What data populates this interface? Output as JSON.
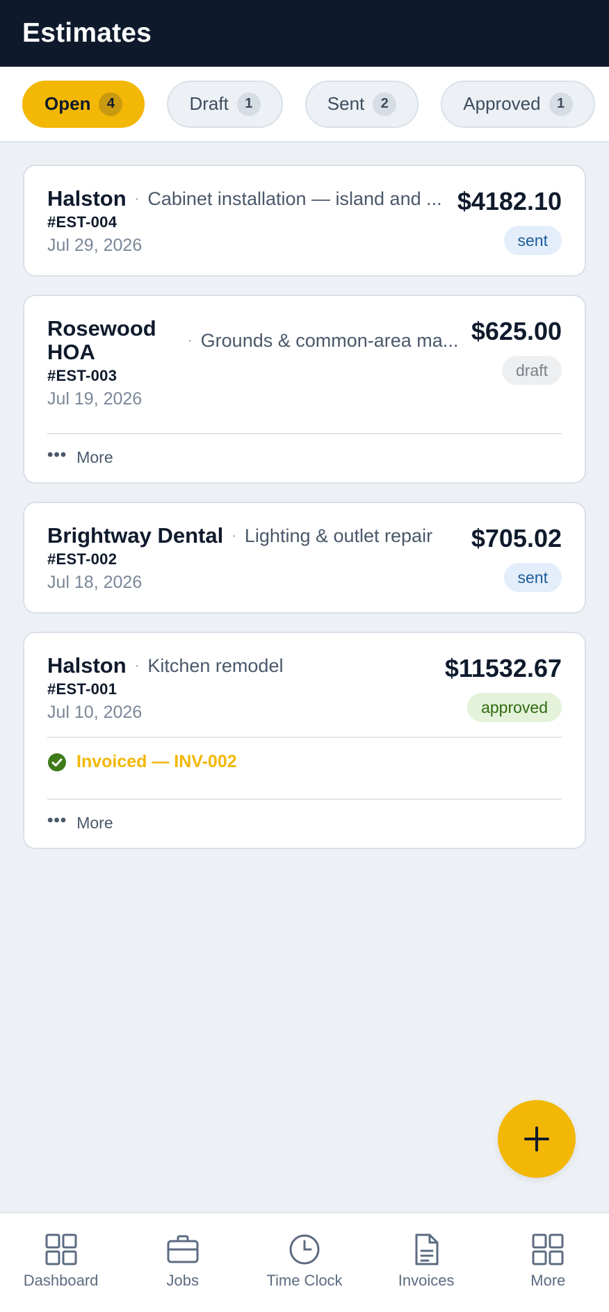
{
  "header": {
    "title": "Estimates"
  },
  "filters": [
    {
      "label": "Open",
      "count": "4",
      "active": true
    },
    {
      "label": "Draft",
      "count": "1"
    },
    {
      "label": "Sent",
      "count": "2"
    },
    {
      "label": "Approved",
      "count": "1"
    }
  ],
  "estimates": [
    {
      "client": "Halston",
      "description": "Cabinet installation — island and ...",
      "number": "#EST-004",
      "date": "Jul 29, 2026",
      "amount": "$4182.10",
      "status": "sent"
    },
    {
      "client": "Rosewood HOA",
      "description": "Grounds & common-area ma...",
      "number": "#EST-003",
      "date": "Jul 19, 2026",
      "amount": "$625.00",
      "status": "draft",
      "more_label": "More"
    },
    {
      "client": "Brightway Dental",
      "description": "Lighting & outlet repair",
      "number": "#EST-002",
      "date": "Jul 18, 2026",
      "amount": "$705.02",
      "status": "sent"
    },
    {
      "client": "Halston",
      "description": "Kitchen remodel",
      "number": "#EST-001",
      "date": "Jul 10, 2026",
      "amount": "$11532.67",
      "status": "approved",
      "invoiced_label": "Invoiced — INV-002",
      "more_label": "More"
    }
  ],
  "fab": {
    "icon": "plus-icon"
  },
  "bottom_nav": [
    {
      "label": "Dashboard",
      "icon": "grid-icon"
    },
    {
      "label": "Jobs",
      "icon": "briefcase-icon"
    },
    {
      "label": "Time Clock",
      "icon": "clock-icon"
    },
    {
      "label": "Invoices",
      "icon": "document-icon"
    },
    {
      "label": "More",
      "icon": "grid-icon"
    }
  ],
  "colors": {
    "header_bg": "#0e1a2c",
    "accent": "#f3b705",
    "background": "#edf1f6",
    "sent_badge": "#e3eefa",
    "approved_badge": "#e4f2d9",
    "approved_check": "#3f7a1a"
  }
}
